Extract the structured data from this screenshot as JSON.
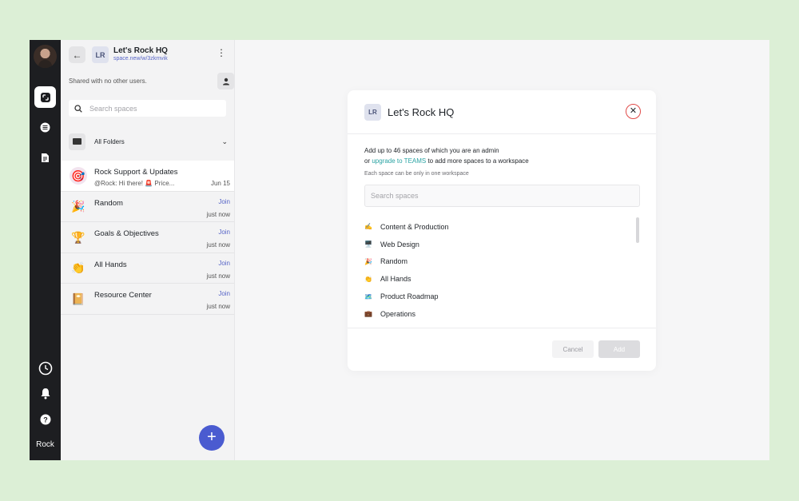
{
  "rail": {
    "label": "Rock",
    "icons": [
      "avatar",
      "space-icon",
      "list-icon",
      "document-icon",
      "history-icon",
      "bell-icon",
      "help-icon"
    ]
  },
  "sidebar": {
    "workspace_badge": "LR",
    "workspace_name": "Let's Rock HQ",
    "workspace_url": "space.new/w/3zkmvik",
    "shared_text": "Shared with no other users.",
    "search_placeholder": "Search spaces",
    "folders_label": "All Folders",
    "items": [
      {
        "title": "Rock Support & Updates",
        "subtitle": "@Rock: Hi there! 🚨 Price...",
        "join": "",
        "time": "Jun 15",
        "icon": "🎯",
        "icon_bg": "#f2e3ee"
      },
      {
        "title": "Random",
        "subtitle": "",
        "join": "Join",
        "time": "just now",
        "icon": "🎉",
        "icon_bg": "transparent"
      },
      {
        "title": "Goals & Objectives",
        "subtitle": "",
        "join": "Join",
        "time": "just now",
        "icon": "🏆",
        "icon_bg": "transparent"
      },
      {
        "title": "All Hands",
        "subtitle": "",
        "join": "Join",
        "time": "just now",
        "icon": "👏",
        "icon_bg": "transparent"
      },
      {
        "title": "Resource Center",
        "subtitle": "",
        "join": "Join",
        "time": "just now",
        "icon": "📔",
        "icon_bg": "transparent"
      }
    ],
    "fab_label": "+"
  },
  "modal": {
    "badge": "LR",
    "title": "Let's Rock HQ",
    "close_label": "✕",
    "info_line1": "Add up to 46 spaces of which you are an admin",
    "info_line2_prefix": "or ",
    "info_line2_link": "upgrade to TEAMS",
    "info_line2_suffix": " to add more spaces to a workspace",
    "note": "Each space can be only in one workspace",
    "search_placeholder": "Search spaces",
    "spaces": [
      {
        "emoji": "✍️",
        "name": "Content & Production"
      },
      {
        "emoji": "🖥️",
        "name": "Web Design"
      },
      {
        "emoji": "🎉",
        "name": "Random"
      },
      {
        "emoji": "👏",
        "name": "All Hands"
      },
      {
        "emoji": "🗺️",
        "name": "Product Roadmap"
      },
      {
        "emoji": "💼",
        "name": "Operations"
      }
    ],
    "cancel_label": "Cancel",
    "add_label": "Add"
  },
  "colors": {
    "accent": "#4a5bd0",
    "link": "#2aa3a3",
    "close_ring": "#e04a48",
    "rail_bg": "#1d1e21",
    "page_bg": "#dcefd6"
  }
}
